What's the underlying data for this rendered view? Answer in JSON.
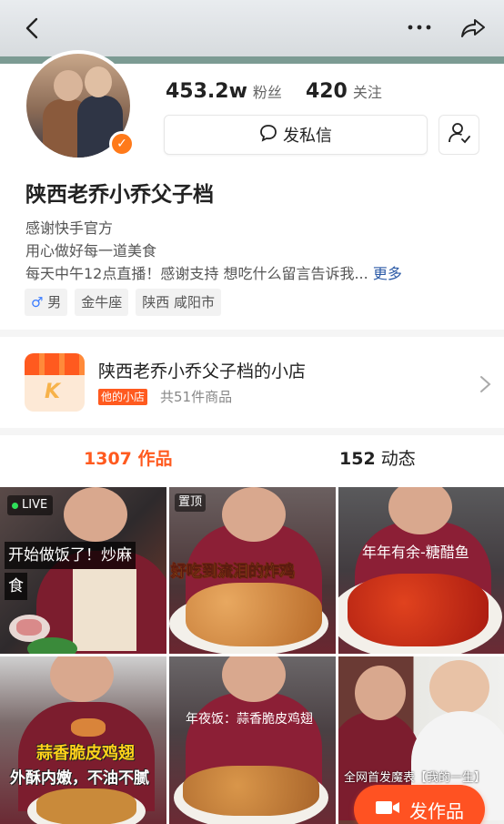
{
  "stats": {
    "followers_value": "453.2w",
    "followers_label": "粉丝",
    "following_value": "420",
    "following_label": "关注"
  },
  "actions": {
    "message_label": "发私信"
  },
  "profile": {
    "name": "陕西老乔小乔父子档",
    "bio_lines": [
      "感谢快手官方",
      "用心做好每一道美食",
      "每天中午12点直播！感谢支持 想吃什么留言告诉我..."
    ],
    "bio_more": "更多",
    "tags": {
      "gender_symbol": "♂",
      "gender": "男",
      "zodiac": "金牛座",
      "location": "陕西 咸阳市"
    }
  },
  "shop": {
    "title": "陕西老乔小乔父子档的小店",
    "badge": "他的小店",
    "count": "共51件商品",
    "icon_letter": "K"
  },
  "tabs": {
    "works_count": "1307",
    "works_label": "作品",
    "moments_count": "152",
    "moments_label": "动态"
  },
  "grid": {
    "items": [
      {
        "badge": "LIVE",
        "caption_line1": "开始做饭了！炒麻",
        "caption_line2": "食"
      },
      {
        "badge": "置顶",
        "caption": "好吃到流泪的炸鸡"
      },
      {
        "caption": "年年有余-糖醋鱼"
      },
      {
        "caption_line1": "蒜香脆皮鸡翅",
        "caption_line2": "外酥内嫩，不油不腻"
      },
      {
        "caption": "年夜饭：蒜香脆皮鸡翅"
      },
      {
        "caption": "全网首发魔表【我的一生】"
      }
    ]
  },
  "fab": {
    "label": "发作品"
  },
  "colors": {
    "accent": "#ff5a1f",
    "link": "#2b5aa6"
  }
}
